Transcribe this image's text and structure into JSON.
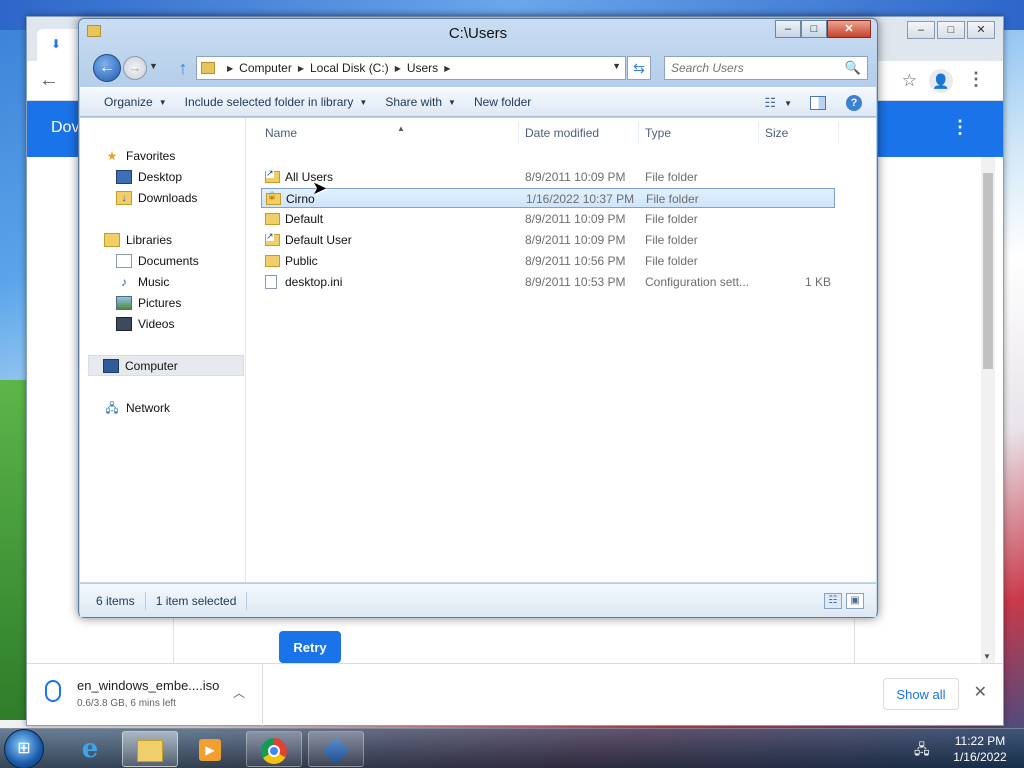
{
  "explorer": {
    "title": "C:\\Users",
    "breadcrumbs": [
      "Computer",
      "Local Disk (C:)",
      "Users"
    ],
    "search_placeholder": "Search Users",
    "toolbar": {
      "organize": "Organize",
      "include": "Include selected folder in library",
      "share": "Share with",
      "new_folder": "New folder"
    },
    "nav_pane": {
      "favorites": "Favorites",
      "desktop": "Desktop",
      "downloads": "Downloads",
      "libraries": "Libraries",
      "documents": "Documents",
      "music": "Music",
      "pictures": "Pictures",
      "videos": "Videos",
      "computer": "Computer",
      "network": "Network"
    },
    "columns": {
      "name": "Name",
      "date": "Date modified",
      "type": "Type",
      "size": "Size"
    },
    "files": [
      {
        "name": "All Users",
        "date": "8/9/2011 10:09 PM",
        "type": "File folder",
        "size": "",
        "icon": "shortcut-folder-icon"
      },
      {
        "name": "Cirno",
        "date": "1/16/2022 10:37 PM",
        "type": "File folder",
        "size": "",
        "icon": "locked-folder-icon"
      },
      {
        "name": "Default",
        "date": "8/9/2011 10:09 PM",
        "type": "File folder",
        "size": "",
        "icon": "folder-icon"
      },
      {
        "name": "Default User",
        "date": "8/9/2011 10:09 PM",
        "type": "File folder",
        "size": "",
        "icon": "shortcut-folder-icon"
      },
      {
        "name": "Public",
        "date": "8/9/2011 10:56 PM",
        "type": "File folder",
        "size": "",
        "icon": "folder-icon"
      },
      {
        "name": "desktop.ini",
        "date": "8/9/2011 10:53 PM",
        "type": "Configuration sett...",
        "size": "1 KB",
        "icon": "file-icon"
      }
    ],
    "status": {
      "count": "6 items",
      "selected": "1 item selected"
    }
  },
  "chrome": {
    "header_text": "Dov",
    "retry_label": "Retry",
    "download": {
      "filename": "en_windows_embe....iso",
      "progress": "0.6/3.8 GB, 6 mins left"
    },
    "show_all": "Show all"
  },
  "taskbar": {
    "time": "11:22 PM",
    "date": "1/16/2022"
  }
}
